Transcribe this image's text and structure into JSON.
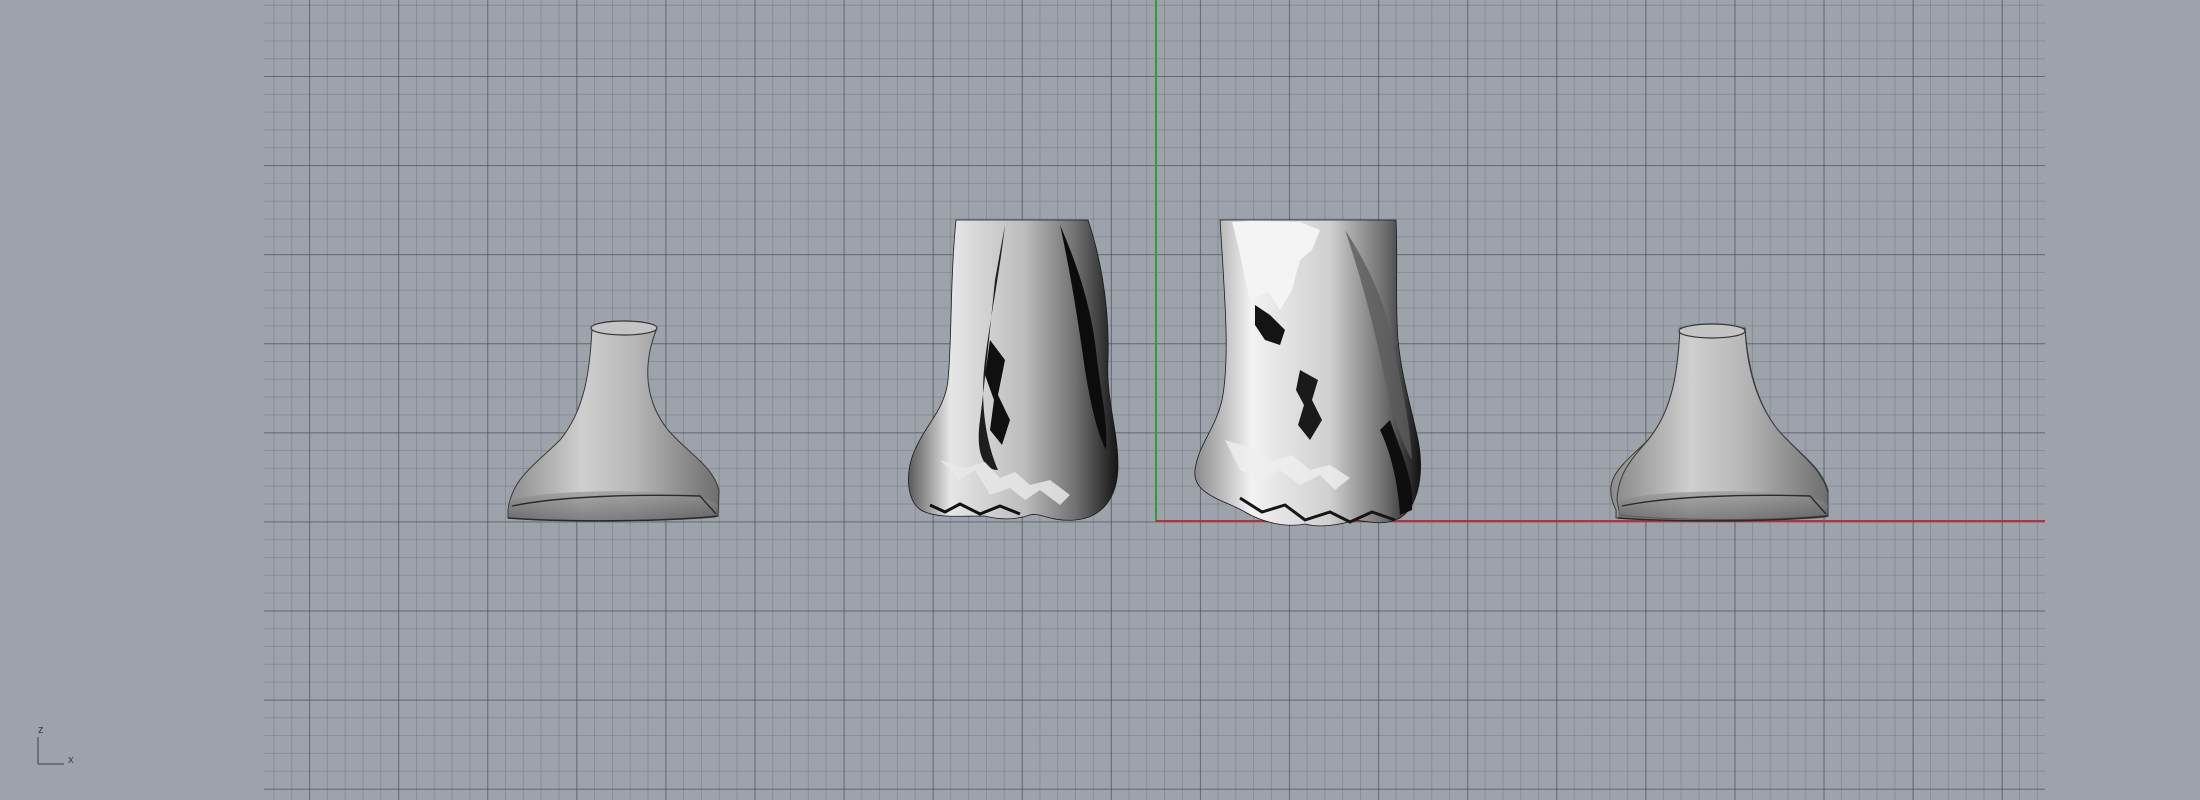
{
  "viewport": {
    "name": "Front",
    "background_color": "#9ea3ab",
    "grid_line_color": "#5a5f69",
    "x_axis_color": "#b8303b",
    "y_axis_color": "#2e9e3a"
  },
  "axis_widget": {
    "vertical_label": "z",
    "horizontal_label": "x"
  },
  "objects": [
    {
      "kind": "smooth-cone-shell",
      "shading": "shaded"
    },
    {
      "kind": "scanned-mesh",
      "shading": "shaded"
    },
    {
      "kind": "scanned-mesh",
      "shading": "shaded"
    },
    {
      "kind": "smooth-cone-shell",
      "shading": "shaded"
    }
  ]
}
